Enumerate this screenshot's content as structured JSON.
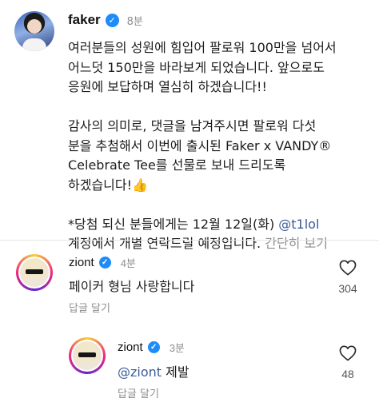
{
  "post": {
    "username": "faker",
    "time": "8분",
    "caption_lines_1": "여러분들의 성원에 힘입어 팔로워 100만을 넘어서\n어느덧 150만을 바라보게 되었습니다. 앞으로도\n응원에 보답하며 열심히 하겠습니다!!",
    "caption_lines_2": "감사의 의미로, 댓글을 남겨주시면 팔로워 다섯\n분을 추첨해서 이번에 출시된 Faker x VANDY®\nCelebrate Tee를 선물로 보내 드리도록\n하겠습니다!👍",
    "caption_3_prefix": "*당첨 되신 분들에게는 12월 12일(화) ",
    "caption_3_mention": "@t1lol",
    "caption_4": "계정에서 개별 연락드릴 예정입니다. ",
    "collapse_label": "간단히 보기"
  },
  "comments": [
    {
      "username": "ziont",
      "time": "4분",
      "text": "페이커 형님 사랑합니다",
      "reply_label": "답글 달기",
      "likes": "304"
    },
    {
      "username": "ziont",
      "time": "3분",
      "mention": "@ziont",
      "text": " 제발",
      "reply_label": "답글 달기",
      "likes": "48"
    }
  ],
  "icons": {
    "verified": "verified-badge-icon",
    "like": "heart-outline-icon"
  },
  "colors": {
    "verified": "#1d8cf8",
    "mention": "#3b5b99",
    "muted": "#8e8e8e"
  }
}
